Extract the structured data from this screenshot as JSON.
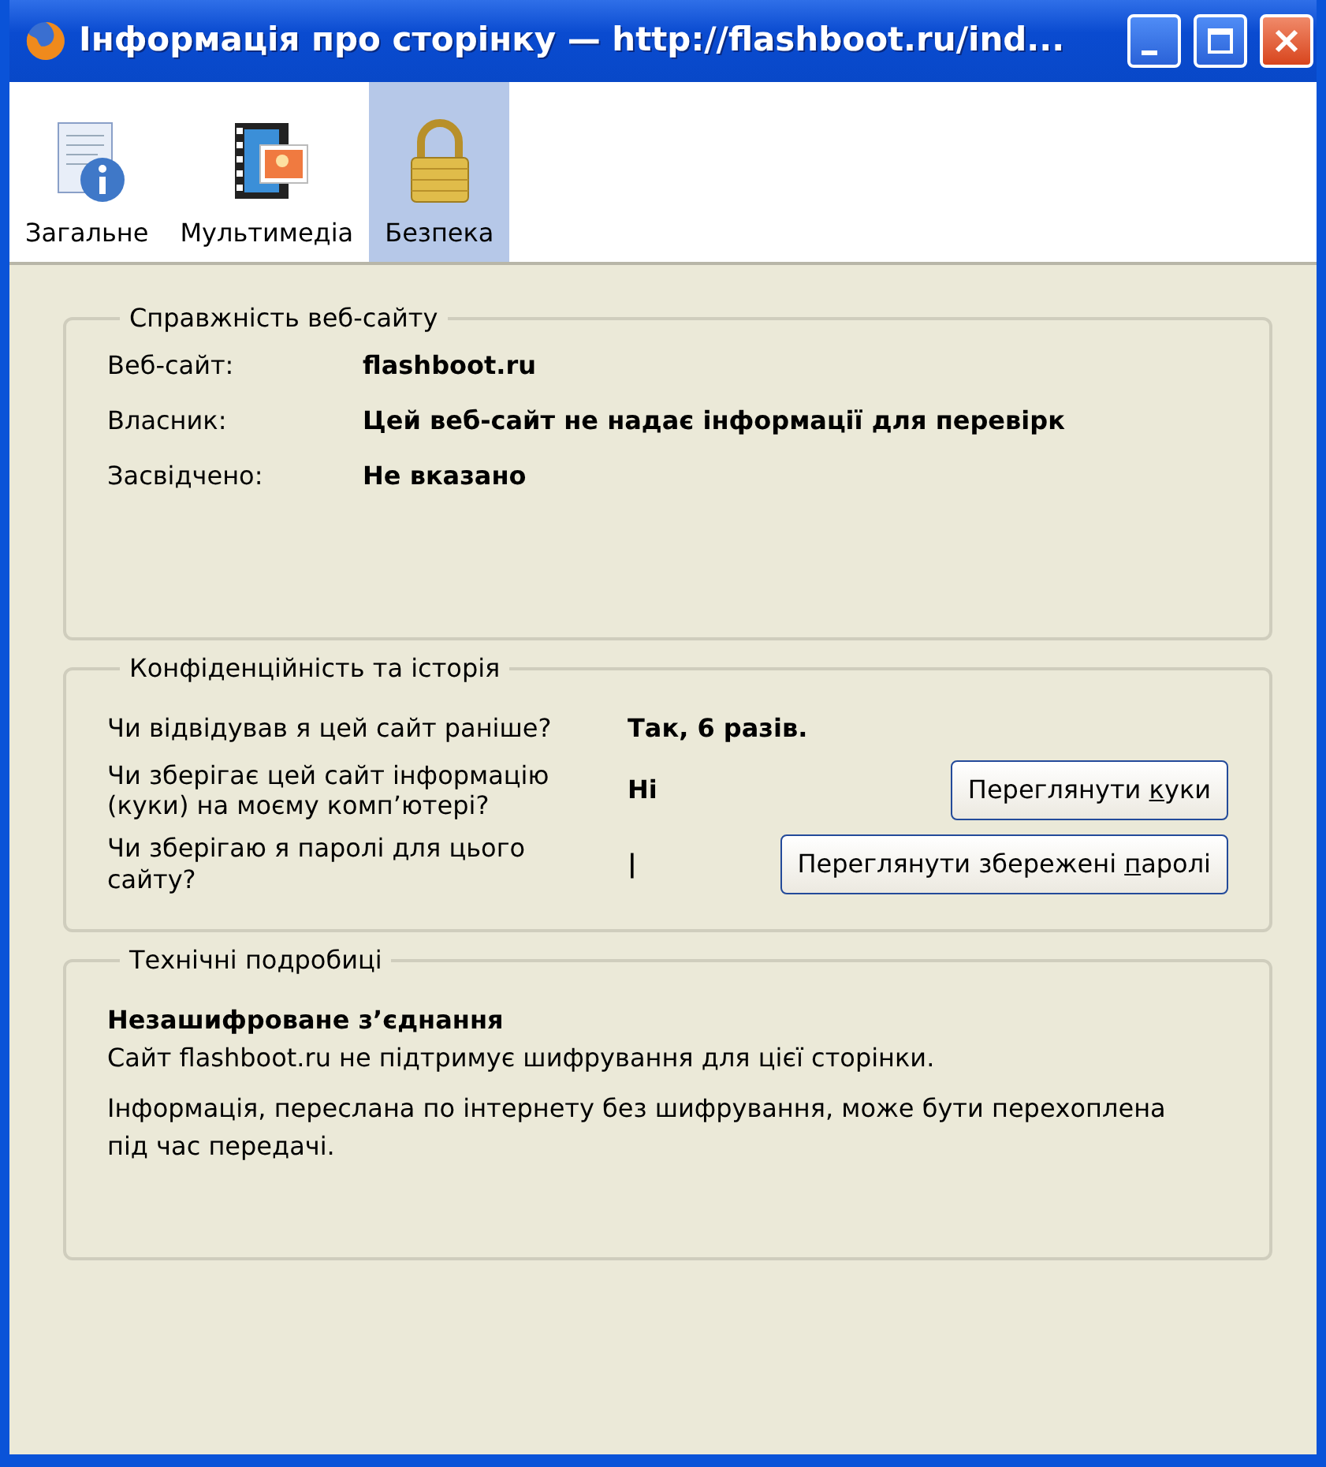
{
  "window": {
    "title": "Інформація про сторінку — http://flashboot.ru/ind..."
  },
  "tabs": [
    {
      "label": "Загальне",
      "kind": "general",
      "selected": false
    },
    {
      "label": "Мультимедіа",
      "kind": "media",
      "selected": false
    },
    {
      "label": "Безпека",
      "kind": "security",
      "selected": true
    }
  ],
  "sections": [
    {
      "kind": "identity",
      "title": "Справжність веб-сайту",
      "rows": [
        {
          "label": "Веб-сайт:",
          "value": "flashboot.ru"
        },
        {
          "label": "Власник:",
          "value": "Цей веб-сайт не надає інформації для перевірк"
        },
        {
          "label": "Засвідчено:",
          "value": "Не вказано"
        }
      ]
    },
    {
      "kind": "privacy",
      "title": "Конфіденційність та історія",
      "rows": [
        {
          "question": "Чи відвідував я цей сайт раніше?",
          "answer": "Так, 6 разів."
        },
        {
          "question": "Чи зберігає цей сайт інформацію (куки) на моєму комп’ютері?",
          "answer": "Ні",
          "button": {
            "before": "Переглянути ",
            "key": "к",
            "after": "уки"
          }
        },
        {
          "question": "Чи зберігаю я паролі для цього сайту?",
          "answer": "|",
          "button": {
            "before": "Переглянути збережені ",
            "key": "п",
            "after": "аролі"
          }
        }
      ]
    },
    {
      "kind": "technical",
      "title": "Технічні подробиці",
      "heading": "Незашифроване з’єднання",
      "paragraphs": [
        "Сайт flashboot.ru не підтримує шифрування для цієї сторінки.",
        "Інформація, переслана по інтернету без шифрування, може бути перехоплена під час передачі."
      ]
    }
  ]
}
